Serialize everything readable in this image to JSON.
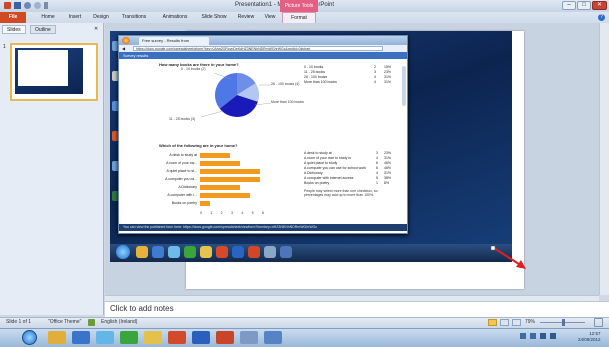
{
  "window": {
    "title": "Presentation1 - Microsoft PowerPoint",
    "context_tab": "Picture Tools",
    "minimize": "–",
    "maximize": "□",
    "close": "✕"
  },
  "ribbon": {
    "tabs": [
      "File",
      "Home",
      "Insert",
      "Design",
      "Transitions",
      "Animations",
      "Slide Show",
      "Review",
      "View",
      "Format"
    ],
    "help": "?"
  },
  "left_pane": {
    "tabs": [
      "Slides",
      "Outline"
    ],
    "close": "✕",
    "thumb_number": "1"
  },
  "embedded": {
    "browser_tab": "Free survey - Results from SurveyGizmo",
    "url": "https://docs.google.com/spreadsheet/gform?key=0Ahg2ORcvpDeKdHZ3NENhNDRmWGhrWGc&gridId=0#chart",
    "header": "Survey results",
    "q1": "How many books are there in your home?",
    "q1_table": [
      [
        "0 - 10 books",
        "2",
        "15%"
      ],
      [
        "11 - 25 books",
        "3",
        "23%"
      ],
      [
        "26 - 100 books",
        "4",
        "31%"
      ],
      [
        "More than 100 books",
        "4",
        "31%"
      ]
    ],
    "pie_labels": [
      "0 - 10 books (2)",
      "26 - 100 books (4)",
      "More than 100 books",
      "11 - 25 books (3)"
    ],
    "q2": "Which of the following are in your home?",
    "q2_bars": [
      {
        "label": "A desk to study at",
        "value": 3
      },
      {
        "label": "A room of your ow...",
        "value": 4
      },
      {
        "label": "A quiet place to st...",
        "value": 6
      },
      {
        "label": "A computer you ca...",
        "value": 6
      },
      {
        "label": "A Dictionary",
        "value": 4
      },
      {
        "label": "A computer with i...",
        "value": 5
      },
      {
        "label": "Books on poetry",
        "value": 1
      }
    ],
    "q2_axis": [
      "0",
      "1",
      "2",
      "3",
      "4",
      "5",
      "6"
    ],
    "q2_table": [
      [
        "A desk to study at",
        "3",
        "23%"
      ],
      [
        "A room of your own to study in",
        "4",
        "31%"
      ],
      [
        "A quiet place to study",
        "6",
        "46%"
      ],
      [
        "A computer you can use for school work",
        "6",
        "46%"
      ],
      [
        "A Dictionary",
        "4",
        "31%"
      ],
      [
        "A computer with internet access",
        "5",
        "38%"
      ],
      [
        "Books on poetry",
        "1",
        "8%"
      ]
    ],
    "q2_note": "People may select more than one checkbox, so percentages may add up to more than 100%.",
    "footer": "You can view the published form here: https://docs.google.com/spreadsheet/viewform?formkey=dHZ3NENhNDRmWGhrWGc"
  },
  "notes": {
    "placeholder": "Click to add notes"
  },
  "status": {
    "slide": "Slide 1 of 1",
    "theme": "\"Office Theme\"",
    "language": "English (Ireland)",
    "zoom": "79%"
  },
  "taskbar": {
    "time": "12:57",
    "date": "24/09/2012"
  },
  "colors": {
    "file_tab": "#d04b24",
    "bar": "#f49a1e",
    "pie_dark": "#1a1ab8",
    "pie_light": "#4f78e6",
    "arrow": "#e02020"
  }
}
